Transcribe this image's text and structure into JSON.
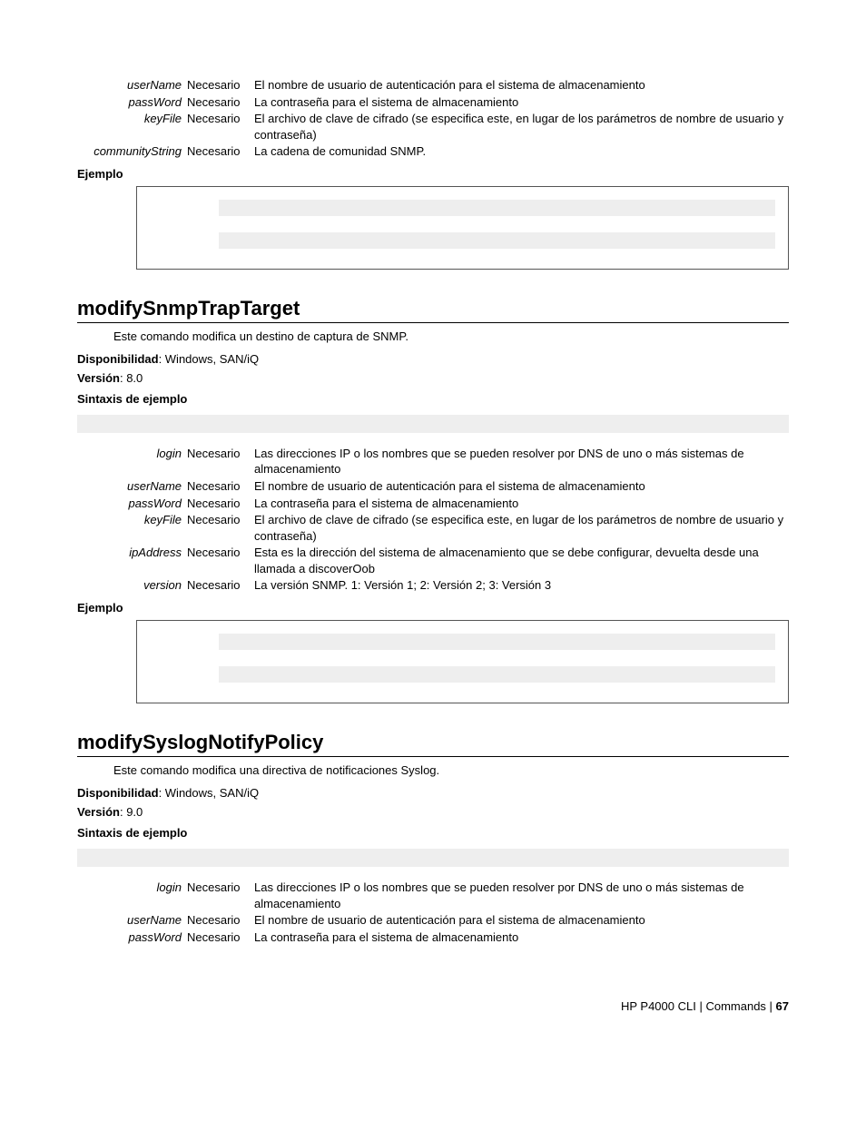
{
  "top_params": [
    {
      "name": "userName",
      "req": "Necesario",
      "desc": "El nombre de usuario de autenticación para el sistema de almacenamiento"
    },
    {
      "name": "passWord",
      "req": "Necesario",
      "desc": "La contraseña para el sistema de almacenamiento"
    },
    {
      "name": "keyFile",
      "req": "Necesario",
      "desc": "El archivo de clave de cifrado (se especifica este, en lugar de los parámetros de nombre de usuario y contraseña)"
    },
    {
      "name": "communityString",
      "req": "Necesario",
      "desc": "La cadena de comunidad SNMP."
    }
  ],
  "labels": {
    "ejemplo": "Ejemplo",
    "disponibilidad_label": "Disponibilidad",
    "version_label": "Versión",
    "sintaxis": "Sintaxis de ejemplo"
  },
  "cmd1": {
    "heading": "modifySnmpTrapTarget",
    "intro": "Este comando modifica un destino de captura de SNMP.",
    "disponibilidad": ": Windows, SAN/iQ",
    "version": ": 8.0",
    "params": [
      {
        "name": "login",
        "req": "Necesario",
        "desc": "Las direcciones IP o los nombres que se pueden resolver por DNS de uno o más sistemas de almacenamiento"
      },
      {
        "name": "userName",
        "req": "Necesario",
        "desc": "El nombre de usuario de autenticación para el sistema de almacenamiento"
      },
      {
        "name": "passWord",
        "req": "Necesario",
        "desc": "La contraseña para el sistema de almacenamiento"
      },
      {
        "name": "keyFile",
        "req": "Necesario",
        "desc": "El archivo de clave de cifrado (se especifica este, en lugar de los parámetros de nombre de usuario y contraseña)"
      },
      {
        "name": "ipAddress",
        "req": "Necesario",
        "desc": "Esta es la dirección del sistema de almacenamiento que se debe configurar, devuelta desde una llamada a discoverOob"
      },
      {
        "name": "version",
        "req": "Necesario",
        "desc": "La versión SNMP. 1: Versión 1; 2: Versión 2; 3: Versión 3"
      }
    ]
  },
  "cmd2": {
    "heading": "modifySyslogNotifyPolicy",
    "intro": "Este comando modifica una directiva de notificaciones Syslog.",
    "disponibilidad": ": Windows, SAN/iQ",
    "version": ": 9.0",
    "params": [
      {
        "name": "login",
        "req": "Necesario",
        "desc": "Las direcciones IP o los nombres que se pueden resolver por DNS de uno o más sistemas de almacenamiento"
      },
      {
        "name": "userName",
        "req": "Necesario",
        "desc": "El nombre de usuario de autenticación para el sistema de almacenamiento"
      },
      {
        "name": "passWord",
        "req": "Necesario",
        "desc": "La contraseña para el sistema de almacenamiento"
      }
    ]
  },
  "footer": {
    "product": "HP P4000 CLI",
    "sep": " | ",
    "section": "Commands",
    "page": "67"
  }
}
